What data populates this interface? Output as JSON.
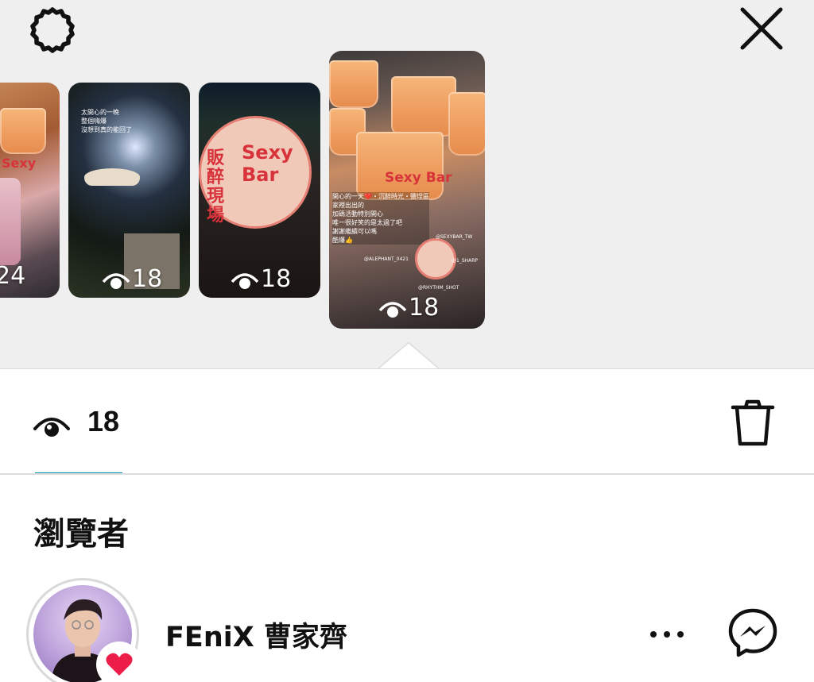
{
  "top_bar": {
    "settings_icon": "gear-icon",
    "close_icon": "close-icon"
  },
  "stories": [
    {
      "views": "24"
    },
    {
      "views": "18",
      "caption": "太開心的一晚\n整個嗨爆\n沒想到真的能回了"
    },
    {
      "views": "18",
      "coaster_text": "販醉現場",
      "coaster_brand": "Sexy Bar"
    },
    {
      "views": "18",
      "caption": "開心的一天❤️・沉醉時光・鹽埕區\n家裡出出的\n加碼活動特別開心\n唯一很好笑的是太過了吧\n謝謝繼續可以嗎\n酷爆👍",
      "cup_brand": "Sexy Bar",
      "tags": [
        "@ALEPHANT_0421",
        "@SEXYBAR_TW",
        "@1_SHARP",
        "@RHYTHM_SHOT"
      ]
    }
  ],
  "selected_story_index": 3,
  "stats": {
    "view_count": "18",
    "eye_icon": "eye-icon",
    "delete_icon": "trash-icon"
  },
  "viewers_section": {
    "title": "瀏覽者"
  },
  "viewers": [
    {
      "name": "FEniX 曹家齊",
      "reaction_icon": "heart-icon",
      "more_icon": "more-dots-icon",
      "message_icon": "messenger-icon"
    }
  ],
  "colors": {
    "accent_underline": "#0095a8",
    "heart": "#ed1d49",
    "strip_background": "#efefef"
  }
}
